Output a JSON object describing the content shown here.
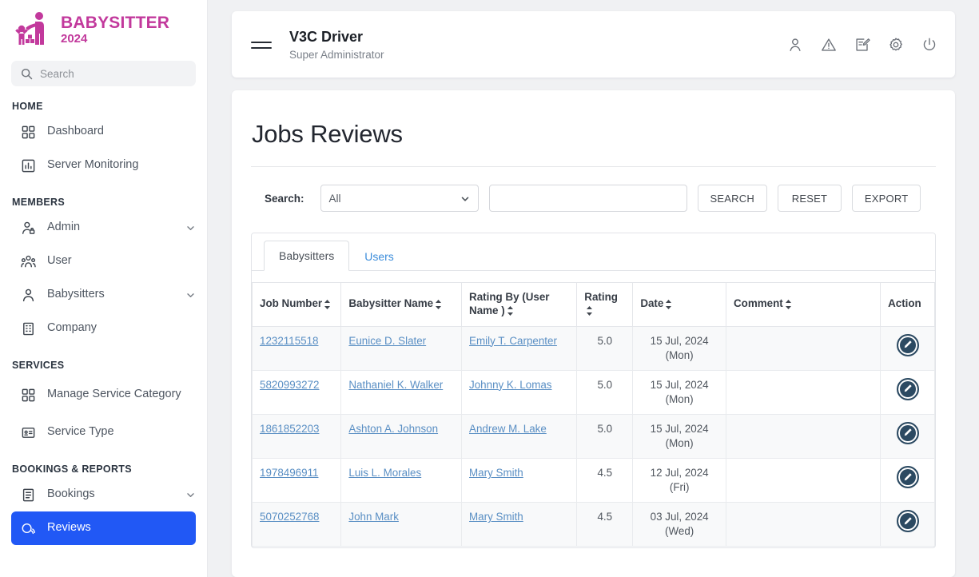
{
  "brand": {
    "name": "BABYSITTER",
    "year": "2024",
    "color": "#c2399c"
  },
  "sidebar": {
    "search_placeholder": "Search",
    "sections": [
      {
        "label": "HOME",
        "items": [
          {
            "label": "Dashboard",
            "icon": "grid-icon",
            "expandable": false,
            "active": false
          },
          {
            "label": "Server Monitoring",
            "icon": "chart-bar-icon",
            "expandable": false,
            "active": false
          }
        ]
      },
      {
        "label": "MEMBERS",
        "items": [
          {
            "label": "Admin",
            "icon": "user-lock-icon",
            "expandable": true,
            "active": false
          },
          {
            "label": "User",
            "icon": "users-group-icon",
            "expandable": false,
            "active": false
          },
          {
            "label": "Babysitters",
            "icon": "user-icon",
            "expandable": true,
            "active": false
          },
          {
            "label": "Company",
            "icon": "building-icon",
            "expandable": false,
            "active": false
          }
        ]
      },
      {
        "label": "SERVICES",
        "items": [
          {
            "label": "Manage Service Category",
            "icon": "grid-icon",
            "expandable": false,
            "active": false,
            "two_line": true
          },
          {
            "label": "Service Type",
            "icon": "card-icon",
            "expandable": false,
            "active": false
          }
        ]
      },
      {
        "label": "BOOKINGS & REPORTS",
        "items": [
          {
            "label": "Bookings",
            "icon": "list-document-icon",
            "expandable": true,
            "active": false
          },
          {
            "label": "Reviews",
            "icon": "review-icon",
            "expandable": false,
            "active": true
          }
        ]
      }
    ]
  },
  "topbar": {
    "title": "V3C Driver",
    "subtitle": "Super Administrator",
    "menu_icon": "hamburger-icon",
    "icons": [
      "profile-icon",
      "alert-triangle-icon",
      "edit-document-icon",
      "gear-icon",
      "power-icon"
    ]
  },
  "main": {
    "page_title": "Jobs Reviews",
    "search": {
      "label": "Search:",
      "select_value": "All",
      "select_options": [
        "All"
      ],
      "input_value": "",
      "input_placeholder": "",
      "buttons": [
        "SEARCH",
        "RESET",
        "EXPORT"
      ]
    },
    "tabs": [
      {
        "label": "Babysitters",
        "active": true
      },
      {
        "label": "Users",
        "active": false
      }
    ],
    "table": {
      "columns": [
        {
          "label": "Job Number",
          "sortable": true,
          "align": "left"
        },
        {
          "label": "Babysitter Name",
          "sortable": true,
          "align": "left"
        },
        {
          "label": "Rating By (User Name )",
          "sortable": true,
          "align": "left"
        },
        {
          "label": "Rating",
          "sortable": true,
          "align": "center"
        },
        {
          "label": "Date",
          "sortable": true,
          "align": "center"
        },
        {
          "label": "Comment",
          "sortable": true,
          "align": "left"
        },
        {
          "label": "Action",
          "sortable": false,
          "align": "center"
        }
      ],
      "rows": [
        {
          "job_number": "1232115518",
          "babysitter_name": "Eunice D. Slater",
          "rating_by": "Emily T. Carpenter",
          "rating": "5.0",
          "date": "15 Jul, 2024 (Mon)",
          "comment": "",
          "action": "edit-icon"
        },
        {
          "job_number": "5820993272",
          "babysitter_name": "Nathaniel K. Walker",
          "rating_by": "Johnny K. Lomas",
          "rating": "5.0",
          "date": "15 Jul, 2024 (Mon)",
          "comment": "",
          "action": "edit-icon"
        },
        {
          "job_number": "1861852203",
          "babysitter_name": "Ashton A. Johnson",
          "rating_by": "Andrew M. Lake",
          "rating": "5.0",
          "date": "15 Jul, 2024 (Mon)",
          "comment": "",
          "action": "edit-icon"
        },
        {
          "job_number": "1978496911",
          "babysitter_name": "Luis L. Morales",
          "rating_by": "Mary Smith",
          "rating": "4.5",
          "date": "12 Jul, 2024 (Fri)",
          "comment": "",
          "action": "edit-icon"
        },
        {
          "job_number": "5070252768",
          "babysitter_name": "John Mark",
          "rating_by": "Mary Smith",
          "rating": "4.5",
          "date": "03 Jul, 2024 (Wed)",
          "comment": "",
          "action": "edit-icon"
        }
      ]
    }
  },
  "colors": {
    "brand_pink": "#c2399c",
    "active_blue": "#2158f5",
    "link_blue": "#5a8fc4",
    "tab_link": "#3c8ddb",
    "edit_button": "#2c4a62",
    "page_bg": "#f0f1f3"
  }
}
